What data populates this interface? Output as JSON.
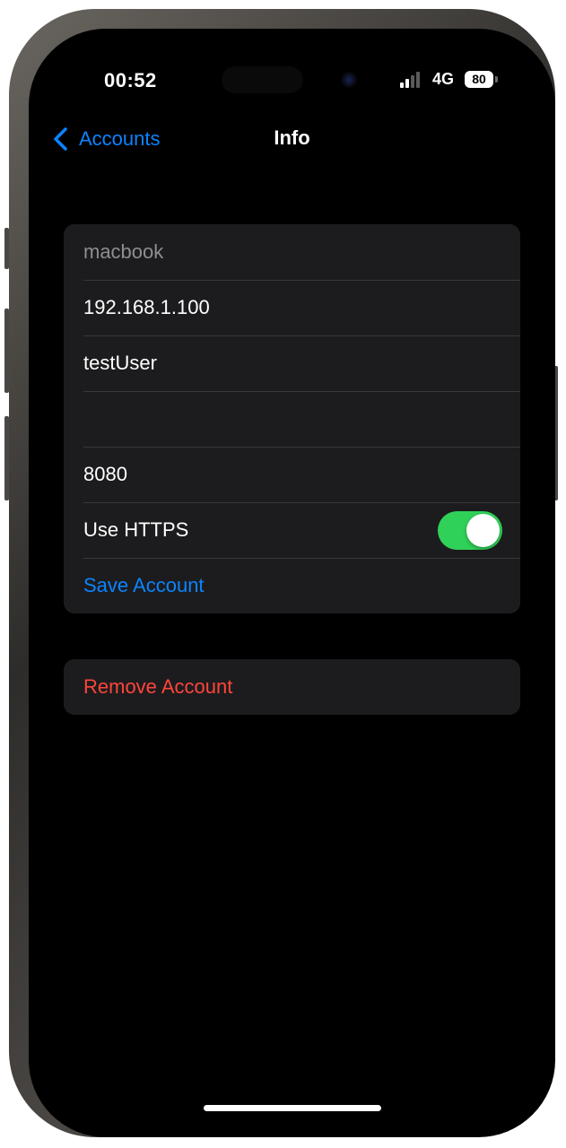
{
  "status_bar": {
    "time": "00:52",
    "network": "4G",
    "battery": "80",
    "signal_bars_active": 2,
    "signal_bars_total": 4
  },
  "nav": {
    "back_label": "Accounts",
    "title": "Info"
  },
  "form": {
    "name_placeholder": "macbook",
    "host": "192.168.1.100",
    "username": "testUser",
    "password": "",
    "port": "8080",
    "https_label": "Use HTTPS",
    "https_enabled": true,
    "save_label": "Save Account"
  },
  "danger": {
    "remove_label": "Remove Account"
  },
  "colors": {
    "accent_blue": "#0a84ff",
    "destructive_red": "#ff453a",
    "toggle_on": "#30d158",
    "cell_background": "#1c1c1e"
  },
  "icons": {
    "back": "chevron-left-icon",
    "signal": "cellular-signal-icon",
    "battery": "battery-icon"
  }
}
